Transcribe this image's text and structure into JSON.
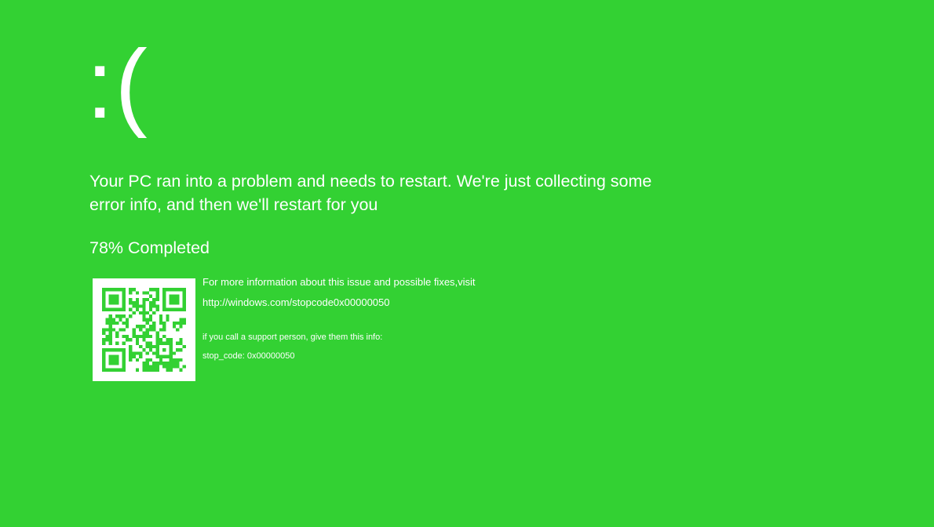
{
  "colors": {
    "background": "#33d133",
    "foreground": "#ffffff",
    "qr_dark": "#33d133",
    "qr_light": "#ffffff"
  },
  "face": ":(",
  "message": "Your PC ran into a problem and needs to restart. We're just collecting some error info, and then we'll restart for you",
  "progress": {
    "percent": 78,
    "text": "78% Completed"
  },
  "qr": {
    "icon": "qr-code-icon"
  },
  "info": {
    "more_info": "For more information about this issue and possible fixes,visit",
    "url": "http://windows.com/stopcode0x00000050",
    "support": "if you call a support person, give them this info:",
    "stop_code": "stop_code: 0x00000050"
  }
}
